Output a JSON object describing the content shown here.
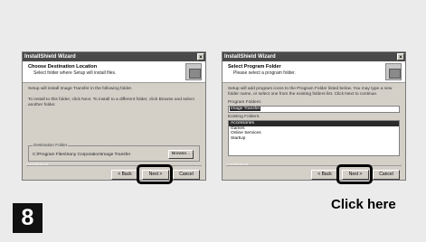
{
  "dialog1": {
    "window_title": "InstallShield Wizard",
    "close_glyph": "×",
    "header_title": "Choose Destination Location",
    "header_subtitle": "Select folder where Setup will install files.",
    "body_text_1": "Setup will install Image Transfer in the following folder.",
    "body_text_2": "To install to this folder, click Next. To install to a different folder, click Browse and select another folder.",
    "dest_legend": "Destination Folder",
    "dest_path": "C:\\Program Files\\Sony Corporation\\Image Transfer",
    "browse_label": "Browse...",
    "shield_label": "InstallShield",
    "back_label": "< Back",
    "next_label": "Next >",
    "cancel_label": "Cancel"
  },
  "dialog2": {
    "window_title": "InstallShield Wizard",
    "close_glyph": "×",
    "header_title": "Select Program Folder",
    "header_subtitle": "Please select a program folder.",
    "body_text": "Setup will add program icons to the Program Folder listed below. You may type a new folder name, or select one from the existing folders list. Click Next to continue.",
    "program_folders_label": "Program Folders:",
    "program_folder_value": "Image Transfer",
    "existing_folders_label": "Existing Folders:",
    "existing_folders": [
      "Accessories",
      "Games",
      "Online Services",
      "StartUp"
    ],
    "shield_label": "InstallShield",
    "back_label": "< Back",
    "next_label": "Next >",
    "cancel_label": "Cancel"
  },
  "step_number": "8",
  "callout": "Click here"
}
